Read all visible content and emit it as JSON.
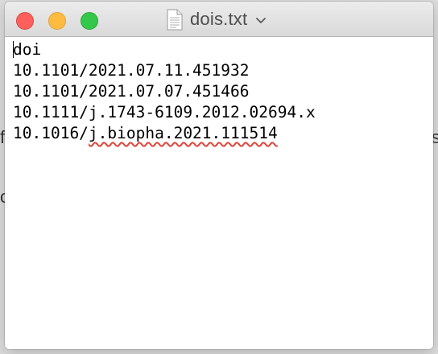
{
  "window": {
    "title": "dois.txt"
  },
  "background_text": {
    "left_a": "f",
    "left_b": "c",
    "right_a": "s"
  },
  "editor": {
    "lines": [
      {
        "prefix": "doi",
        "flagged": ""
      },
      {
        "prefix": "10.1101/2021.07.11.451932",
        "flagged": ""
      },
      {
        "prefix": "10.1101/2021.07.07.451466",
        "flagged": ""
      },
      {
        "prefix": "10.1111/j.1743-6109.2012.02694.x",
        "flagged": ""
      },
      {
        "prefix": "10.1016/",
        "flagged": "j.biopha.2021.111514"
      }
    ]
  },
  "colors": {
    "close": "#fc605c",
    "minimize": "#fdbc40",
    "maximize": "#34c84a",
    "spellcheck_underline": "#e0433a"
  },
  "icons": {
    "file": "text-document-icon",
    "title_menu": "chevron-down-icon"
  }
}
